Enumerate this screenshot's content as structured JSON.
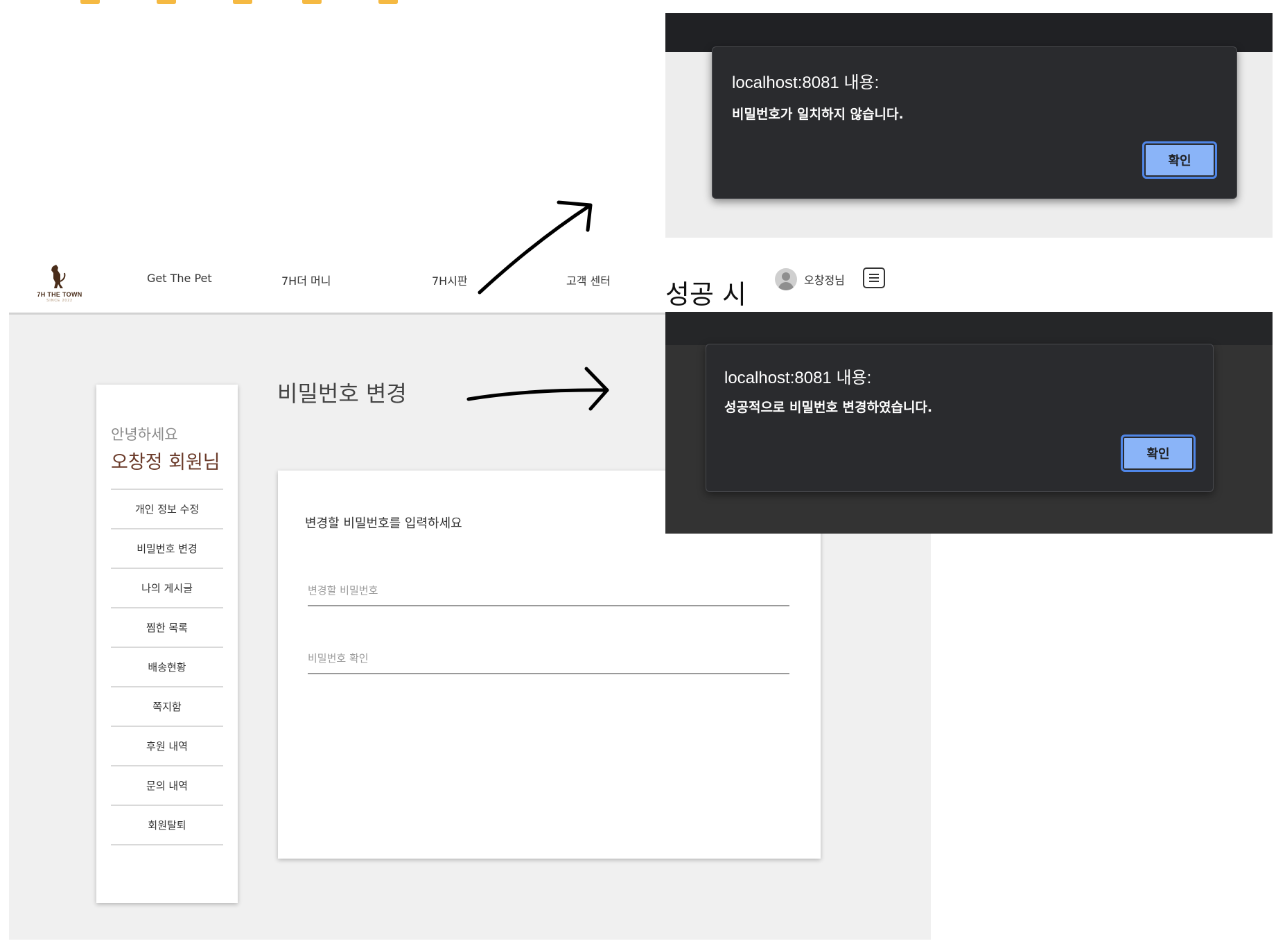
{
  "header": {
    "logo_text": "7H THE TOWN",
    "logo_sub": "SINCE 2022",
    "nav": [
      "Get The Pet",
      "7H더 머니",
      "7H시판",
      "고객 센터"
    ],
    "user_name": "오창정님"
  },
  "sidebar": {
    "greeting": "안녕하세요",
    "member": "오창정 회원님",
    "items": [
      "개인 정보 수정",
      "비밀번호 변경",
      "나의 게시글",
      "찜한 목록",
      "배송현황",
      "쪽지함",
      "후원 내역",
      "문의 내역",
      "회원탈퇴"
    ]
  },
  "main": {
    "title": "비밀번호 변경",
    "prompt": "변경할 비밀번호를 입력하세요",
    "new_password_placeholder": "변경할 비밀번호",
    "confirm_password_placeholder": "비밀번호 확인"
  },
  "alerts": {
    "failure": {
      "title": "localhost:8081 내용:",
      "message": "비밀번호가 일치하지 않습니다.",
      "button": "확인"
    },
    "success_label": "성공 시",
    "success": {
      "title": "localhost:8081 내용:",
      "message": "성공적으로 비밀번호 변경하였습니다.",
      "button": "확인"
    }
  },
  "colors": {
    "brand_brown": "#6b3b2a",
    "dialog_bg": "#2a2b2e",
    "ok_button": "#8ab4f8",
    "page_bg": "#f0f0f0",
    "dash_orange": "#f5b942"
  }
}
